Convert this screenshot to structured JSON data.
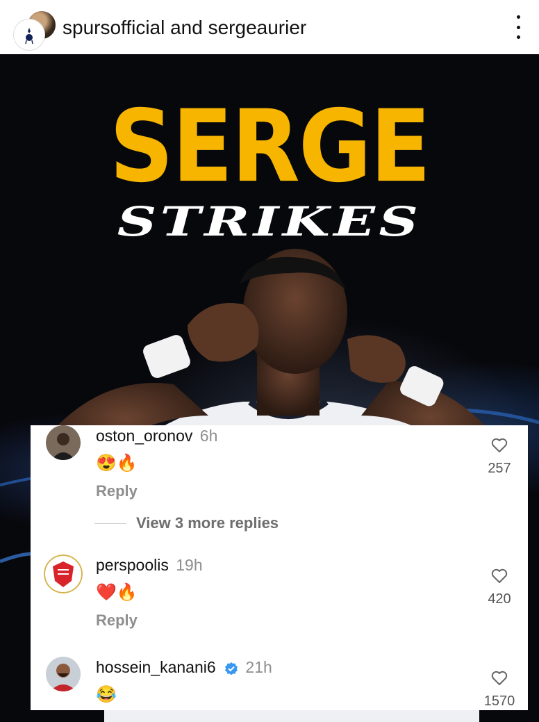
{
  "header": {
    "account1": "spursofficial",
    "connector": "and",
    "account2": "sergeaurier"
  },
  "post": {
    "title_main": "SERGE",
    "title_sub": "STRIKES"
  },
  "comments": {
    "view_more": "View 3 more replies",
    "items": [
      {
        "username": "oston_oronov",
        "time": "6h",
        "emoji": "😍🔥",
        "reply": "Reply",
        "likes": "257"
      },
      {
        "username": "perspoolis",
        "time": "19h",
        "emoji": "❤️🔥",
        "reply": "Reply",
        "likes": "420"
      },
      {
        "username": "hossein_kanani6",
        "time": "21h",
        "emoji": "😂",
        "likes": "1570"
      }
    ]
  },
  "colors": {
    "accent_yellow": "#f7b500",
    "verified_blue": "#3897f0"
  }
}
